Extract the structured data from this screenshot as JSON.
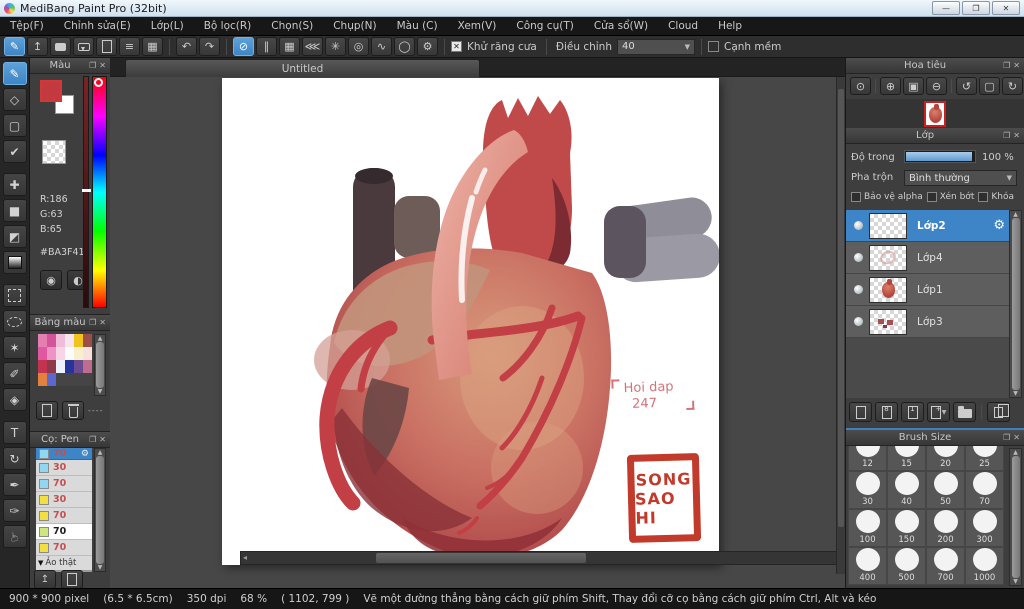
{
  "window": {
    "title": "MediBang Paint Pro (32bit)",
    "control_glyphs": {
      "minimize": "—",
      "maximize": "❐",
      "close": "✕"
    }
  },
  "menubar": {
    "items": [
      "Tệp(F)",
      "Chỉnh sửa(E)",
      "Lớp(L)",
      "Bộ lọc(R)",
      "Chọn(S)",
      "Chụp(N)",
      "Màu (C)",
      "Xem(V)",
      "Công cụ(T)",
      "Cửa sổ(W)",
      "Cloud",
      "Help"
    ]
  },
  "toolbar": {
    "file_buttons": [
      {
        "name": "paint-mode-button",
        "glyph": "✎",
        "selected": true
      },
      {
        "name": "export-button",
        "glyph": "↥"
      },
      {
        "name": "comment-button",
        "glyph": "css:bubble"
      },
      {
        "name": "chat-button",
        "glyph": "css:bubble2"
      },
      {
        "name": "document-button",
        "glyph": "css:page"
      },
      {
        "name": "list-button",
        "glyph": "≡"
      },
      {
        "name": "material-grid-button",
        "glyph": "▦"
      }
    ],
    "history_buttons": [
      {
        "name": "undo-button",
        "glyph": "↶"
      },
      {
        "name": "redo-button",
        "glyph": "↷"
      }
    ],
    "snap_buttons": [
      {
        "name": "snap-off-button",
        "glyph": "⊘",
        "selected": true
      },
      {
        "name": "snap-parallel-button",
        "glyph": "∥"
      },
      {
        "name": "snap-grid-button",
        "glyph": "▦"
      },
      {
        "name": "snap-vanishing-button",
        "glyph": "⋘"
      },
      {
        "name": "snap-radial-button",
        "glyph": "✳"
      },
      {
        "name": "snap-concentric-button",
        "glyph": "◎"
      },
      {
        "name": "snap-curve-button",
        "glyph": "∿"
      },
      {
        "name": "snap-ellipse-button",
        "glyph": "◯"
      },
      {
        "name": "snap-settings-button",
        "glyph": "⚙"
      }
    ],
    "antialias_label": "Khử răng cưa",
    "adjust_label": "Điều chỉnh",
    "adjust_value": "40",
    "soft_edge_label": "Cạnh mềm"
  },
  "tools": [
    {
      "name": "brush-tool",
      "glyph": "✎",
      "selected": true
    },
    {
      "name": "eraser-tool",
      "glyph": "◇"
    },
    {
      "name": "shape-brush-tool",
      "glyph": "▢"
    },
    {
      "name": "polyline-tool",
      "glyph": "✔"
    },
    {
      "name": "move-tool",
      "glyph": "✚",
      "gap": true
    },
    {
      "name": "fill-rect-tool",
      "glyph": "■"
    },
    {
      "name": "bucket-tool",
      "glyph": "◩"
    },
    {
      "name": "gradient-tool",
      "glyph": "css:gradient"
    },
    {
      "name": "select-rect-tool",
      "glyph": "css:marquee",
      "gap": true
    },
    {
      "name": "lasso-tool",
      "glyph": "css:lasso"
    },
    {
      "name": "magic-wand-tool",
      "glyph": "✶"
    },
    {
      "name": "select-pen-tool",
      "glyph": "✐"
    },
    {
      "name": "select-eraser-tool",
      "glyph": "◈"
    },
    {
      "name": "text-tool",
      "glyph": "T",
      "gap": true
    },
    {
      "name": "rotate-view-tool",
      "glyph": "↻"
    },
    {
      "name": "eyedropper-tool",
      "glyph": "✒"
    },
    {
      "name": "divide-tool",
      "glyph": "✑"
    },
    {
      "name": "hand-tool",
      "glyph": "☞",
      "rot": true
    }
  ],
  "color_panel": {
    "title": "Màu",
    "fg_color": "#c23a40",
    "r": "R:186",
    "g": "G:63",
    "b": "B:65",
    "hex": "#BA3F41",
    "buttons": [
      {
        "name": "color-wheel-button",
        "glyph": "◉"
      },
      {
        "name": "color-swap-button",
        "glyph": "◐"
      }
    ]
  },
  "palette_panel": {
    "title": "Bảng màu",
    "swatches": [
      "#e57fb2",
      "#d4549c",
      "#f0bcd8",
      "#f6e4ee",
      "#f1c31f",
      "#9c4f48",
      "#df58a1",
      "#ee93c5",
      "#f6d6e6",
      "#fbfbfc",
      "#f8f0cd",
      "#f8e1dd",
      "#c23350",
      "#8e3a49",
      "#edf1f9",
      "#27349c",
      "#6c4b91",
      "#bd6e8d",
      "#e2813d",
      "#5d68cf",
      "",
      "",
      "",
      ""
    ],
    "footer_dashes": "----"
  },
  "brush_panel": {
    "title": "Cọ: Pen",
    "brushes": [
      {
        "color": "#8fd8f0",
        "size": "70",
        "selected": true
      },
      {
        "color": "#8fd8f0",
        "size": "30"
      },
      {
        "color": "#8fd8f0",
        "size": "70"
      },
      {
        "color": "#f3df3d",
        "size": "30"
      },
      {
        "color": "#f3df3d",
        "size": "70"
      },
      {
        "color": "#cde879",
        "size": "70",
        "light": true
      },
      {
        "color": "#f3df3d",
        "size": "70"
      }
    ],
    "footer_brush": "Ảo thật"
  },
  "navigator": {
    "title": "Hoa tiêu",
    "buttons": [
      {
        "name": "zoom-100-button",
        "glyph": "⊙"
      },
      {
        "name": "zoom-in-button",
        "glyph": "⊕",
        "sep": true
      },
      {
        "name": "fit-canvas-button",
        "glyph": "▣"
      },
      {
        "name": "zoom-out-button",
        "glyph": "⊖"
      },
      {
        "name": "rotate-ccw-button",
        "glyph": "↺",
        "sep": true
      },
      {
        "name": "fit-screen-button",
        "glyph": "▢"
      },
      {
        "name": "reset-rotation-button",
        "glyph": "↻"
      }
    ]
  },
  "layer_panel": {
    "title": "Lớp",
    "opacity_label": "Độ trong",
    "opacity_value": "100 %",
    "blend_label": "Pha trộn",
    "blend_value": "Bình thường",
    "checkboxes": [
      "Bảo vệ alpha",
      "Xén bớt",
      "Khóa"
    ],
    "layers": [
      {
        "name": "Lớp2",
        "selected": true,
        "thumb": "empty"
      },
      {
        "name": "Lớp4",
        "thumb": "sketch"
      },
      {
        "name": "Lớp1",
        "thumb": "heart"
      },
      {
        "name": "Lớp3",
        "thumb": "marks"
      }
    ],
    "bottom_buttons": [
      {
        "name": "new-layer-button",
        "glyph": "css:page"
      },
      {
        "name": "new-8bit-layer-button",
        "glyph": "css:page",
        "badge": "8"
      },
      {
        "name": "new-1bit-layer-button",
        "glyph": "css:page",
        "badge": "1"
      },
      {
        "name": "add-layer-menu-button",
        "glyph": "css:page",
        "badge": "+",
        "caret": true
      },
      {
        "name": "layer-folder-button",
        "glyph": "css:folder"
      },
      {
        "name": "duplicate-layer-button",
        "glyph": "css:pages",
        "sep": true
      }
    ]
  },
  "brush_size_panel": {
    "title": "Brush Size",
    "sizes": [
      "12",
      "15",
      "20",
      "25",
      "30",
      "40",
      "50",
      "70",
      "100",
      "150",
      "200",
      "300",
      "400",
      "500",
      "700",
      "1000"
    ]
  },
  "canvas": {
    "tab": "Untitled",
    "annotation_line1": "Hoi dap",
    "annotation_line2": "247",
    "stamp_line1": "Song",
    "stamp_line2": "Sao Hi"
  },
  "statusbar": {
    "size": "900 * 900 pixel",
    "cm": "(6.5 * 6.5cm)",
    "dpi": "350 dpi",
    "zoom": "68 %",
    "coords": "( 1102, 799 )",
    "hint": "Vẽ một đường thẳng bằng cách giữ phím Shift, Thay đổi cỡ cọ bằng cách giữ phím Ctrl, Alt và kéo"
  }
}
